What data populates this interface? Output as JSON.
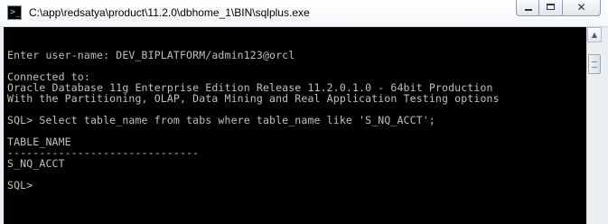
{
  "window": {
    "title": "C:\\app\\redsatya\\product\\11.2.0\\dbhome_1\\BIN\\sqlplus.exe",
    "controls": {
      "minimize": "–",
      "maximize": "□",
      "close": "✕"
    }
  },
  "console": {
    "lines": [
      "",
      "",
      "Enter user-name: DEV_BIPLATFORM/admin123@orcl",
      "",
      "Connected to:",
      "Oracle Database 11g Enterprise Edition Release 11.2.0.1.0 - 64bit Production",
      "With the Partitioning, OLAP, Data Mining and Real Application Testing options",
      "",
      "SQL> Select table_name from tabs where table_name like 'S_NQ_ACCT';",
      "",
      "TABLE_NAME",
      "------------------------------",
      "S_NQ_ACCT",
      "",
      "SQL>",
      "",
      ""
    ]
  },
  "scrollbar": {
    "up_arrow": "▲"
  }
}
